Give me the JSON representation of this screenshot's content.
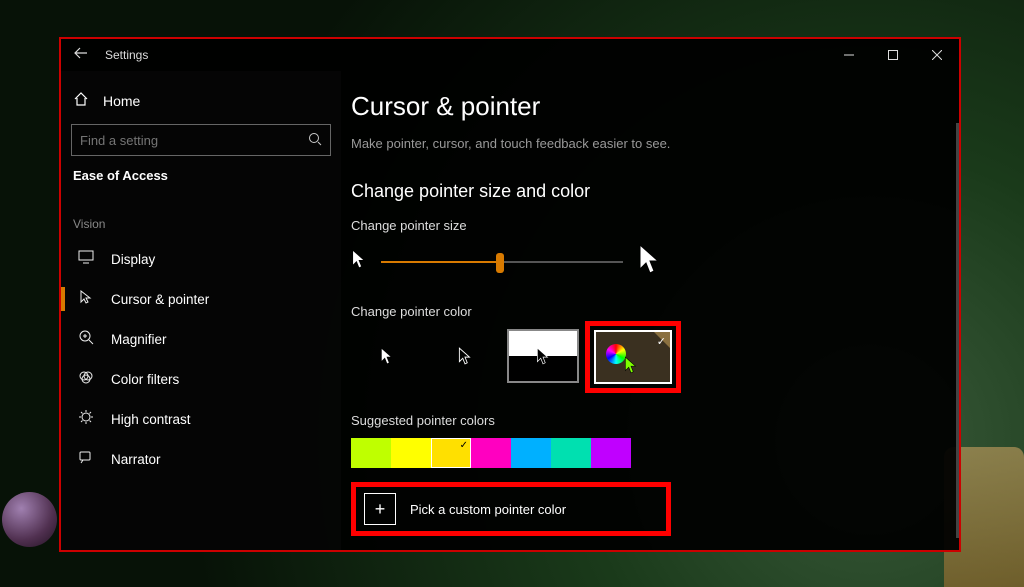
{
  "window": {
    "title": "Settings"
  },
  "sidebar": {
    "home": "Home",
    "search_placeholder": "Find a setting",
    "category": "Ease of Access",
    "group": "Vision",
    "items": [
      {
        "label": "Display"
      },
      {
        "label": "Cursor & pointer"
      },
      {
        "label": "Magnifier"
      },
      {
        "label": "Color filters"
      },
      {
        "label": "High contrast"
      },
      {
        "label": "Narrator"
      }
    ]
  },
  "page": {
    "heading": "Cursor & pointer",
    "description": "Make pointer, cursor, and touch feedback easier to see.",
    "section_heading": "Change pointer size and color",
    "size_label": "Change pointer size",
    "color_label": "Change pointer color",
    "suggested_label": "Suggested pointer colors",
    "custom_label": "Pick a custom pointer color",
    "suggested_colors": [
      "#bfff00",
      "#ffff00",
      "#ffe000",
      "#ff00c0",
      "#00b0ff",
      "#00e0b0",
      "#c000ff"
    ],
    "selected_swatch_index": 2
  }
}
